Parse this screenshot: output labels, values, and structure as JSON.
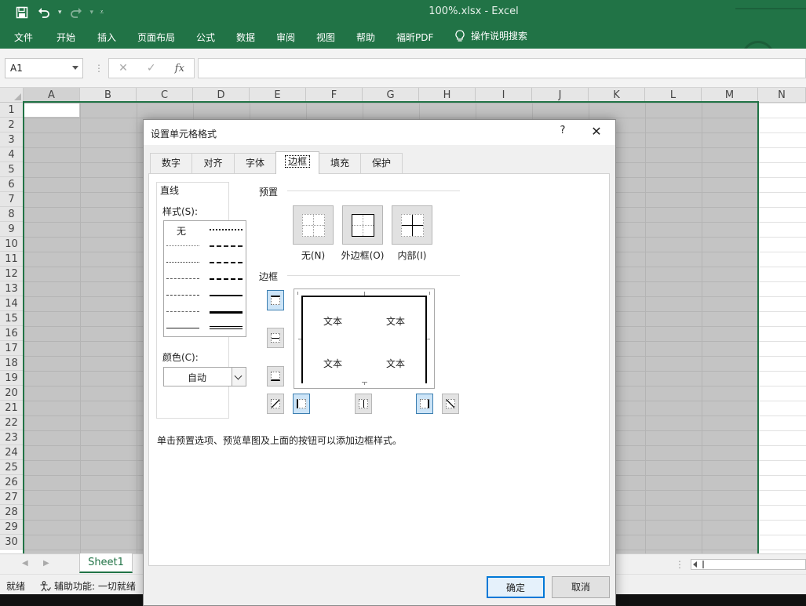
{
  "app": {
    "document_title": "100%.xlsx  -  Excel",
    "quick_access": {
      "save_icon": "save-icon",
      "undo_icon": "undo-icon",
      "redo_icon": "redo-icon",
      "customize_icon": "customize-qat-icon"
    },
    "ribbon_tabs": [
      "文件",
      "开始",
      "插入",
      "页面布局",
      "公式",
      "数据",
      "审阅",
      "视图",
      "帮助",
      "福昕PDF"
    ],
    "tell_me": "操作说明搜索",
    "accent_color": "#217346"
  },
  "formula_bar": {
    "name_box": "A1",
    "cancel_symbol": "✕",
    "enter_symbol": "✓",
    "fx_label": "fx",
    "formula": ""
  },
  "grid": {
    "columns": [
      "A",
      "B",
      "C",
      "D",
      "E",
      "F",
      "G",
      "H",
      "I",
      "J",
      "K",
      "L",
      "M",
      "N"
    ],
    "rows": [
      "1",
      "2",
      "3",
      "4",
      "5",
      "6",
      "7",
      "8",
      "9",
      "10",
      "11",
      "12",
      "13",
      "14",
      "15",
      "16",
      "17",
      "18",
      "19",
      "20",
      "21",
      "22",
      "23",
      "24",
      "25",
      "26",
      "27",
      "28",
      "29",
      "30"
    ],
    "active_cell": "A1"
  },
  "sheets": {
    "tabs": [
      "Sheet1"
    ],
    "active": "Sheet1"
  },
  "status": {
    "ready": "就绪",
    "accessibility": "辅助功能: 一切就绪"
  },
  "dialog": {
    "title": "设置单元格格式",
    "help": "?",
    "close": "✕",
    "tabs": [
      "数字",
      "对齐",
      "字体",
      "边框",
      "填充",
      "保护"
    ],
    "active_tab": "边框",
    "line_group": {
      "title": "直线",
      "style_label": "样式(S):",
      "style_none": "无",
      "color_label": "颜色(C):",
      "color_value": "自动"
    },
    "presets": {
      "title": "预置",
      "items": [
        {
          "label": "无(N)"
        },
        {
          "label": "外边框(O)"
        },
        {
          "label": "内部(I)"
        }
      ]
    },
    "border": {
      "title": "边框",
      "preview_text": [
        "文本",
        "文本",
        "文本",
        "文本"
      ],
      "toggles": {
        "top": true,
        "inside_horizontal": false,
        "bottom": false,
        "diagonal_up": false,
        "left": true,
        "inside_vertical": false,
        "right": true,
        "diagonal_down": false
      }
    },
    "hint": "单击预置选项、预览草图及上面的按钮可以添加边框样式。",
    "ok": "确定",
    "cancel": "取消"
  }
}
